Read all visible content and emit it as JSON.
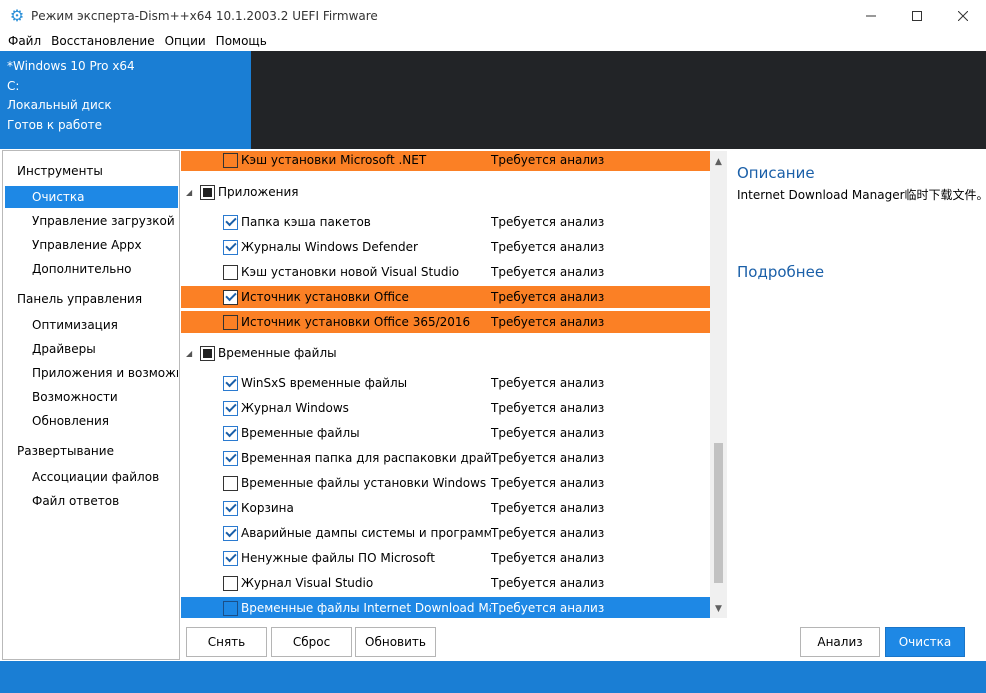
{
  "window": {
    "title": "Режим эксперта-Dism++x64 10.1.2003.2 UEFI Firmware",
    "app_icon": "gear-cluster-icon",
    "controls": [
      "minimize-icon",
      "maximize-icon",
      "close-icon"
    ]
  },
  "menu": [
    "Файл",
    "Восстановление",
    "Опции",
    "Помощь"
  ],
  "image_info": {
    "os": "*Windows 10 Pro x64",
    "drive": "C:",
    "disk": "Локальный диск",
    "status": "Готов к работе"
  },
  "sidebar": {
    "groups": [
      {
        "label": "Инструменты",
        "items": [
          {
            "label": "Очистка",
            "active": true
          },
          {
            "label": "Управление загрузкой",
            "active": false
          },
          {
            "label": "Управление Appx",
            "active": false
          },
          {
            "label": "Дополнительно",
            "active": false
          }
        ]
      },
      {
        "label": "Панель управления",
        "items": [
          {
            "label": "Оптимизация",
            "active": false
          },
          {
            "label": "Драйверы",
            "active": false
          },
          {
            "label": "Приложения и возможнос",
            "active": false
          },
          {
            "label": "Возможности",
            "active": false
          },
          {
            "label": "Обновления",
            "active": false
          }
        ]
      },
      {
        "label": "Развертывание",
        "items": [
          {
            "label": "Ассоциации файлов",
            "active": false
          },
          {
            "label": "Файл ответов",
            "active": false
          }
        ]
      }
    ]
  },
  "list": {
    "rows": [
      {
        "kind": "item",
        "name": "Кэш установки Microsoft .NET",
        "status": "Требуется анализ",
        "checked": false,
        "highlight": "orange"
      },
      {
        "kind": "group",
        "name": "Приложения",
        "state": "partial"
      },
      {
        "kind": "item",
        "name": "Папка кэша пакетов",
        "status": "Требуется анализ",
        "checked": true,
        "highlight": ""
      },
      {
        "kind": "item",
        "name": "Журналы Windows Defender",
        "status": "Требуется анализ",
        "checked": true,
        "highlight": ""
      },
      {
        "kind": "item",
        "name": "Кэш установки новой Visual Studio",
        "status": "Требуется анализ",
        "checked": false,
        "highlight": ""
      },
      {
        "kind": "item",
        "name": "Источник установки Office",
        "status": "Требуется анализ",
        "checked": true,
        "highlight": "orange"
      },
      {
        "kind": "item",
        "name": "Источник установки Office 365/2016",
        "status": "Требуется анализ",
        "checked": false,
        "highlight": "orange"
      },
      {
        "kind": "group",
        "name": "Временные файлы",
        "state": "partial"
      },
      {
        "kind": "item",
        "name": "WinSxS временные файлы",
        "status": "Требуется анализ",
        "checked": true,
        "highlight": ""
      },
      {
        "kind": "item",
        "name": "Журнал Windows",
        "status": "Требуется анализ",
        "checked": true,
        "highlight": ""
      },
      {
        "kind": "item",
        "name": "Временные файлы",
        "status": "Требуется анализ",
        "checked": true,
        "highlight": ""
      },
      {
        "kind": "item",
        "name": "Временная папка для распаковки драйверов",
        "status": "Требуется анализ",
        "checked": true,
        "highlight": ""
      },
      {
        "kind": "item",
        "name": "Временные файлы установки Windows",
        "status": "Требуется анализ",
        "checked": false,
        "highlight": ""
      },
      {
        "kind": "item",
        "name": "Корзина",
        "status": "Требуется анализ",
        "checked": true,
        "highlight": ""
      },
      {
        "kind": "item",
        "name": "Аварийные дампы системы и программ",
        "status": "Требуется анализ",
        "checked": true,
        "highlight": ""
      },
      {
        "kind": "item",
        "name": "Ненужные файлы ПО Microsoft",
        "status": "Требуется анализ",
        "checked": true,
        "highlight": ""
      },
      {
        "kind": "item",
        "name": "Журнал Visual Studio",
        "status": "Требуется анализ",
        "checked": false,
        "highlight": ""
      },
      {
        "kind": "item",
        "name": "Временные файлы Internet Download Manager",
        "status": "Требуется анализ",
        "checked": false,
        "highlight": "blue"
      }
    ]
  },
  "description": {
    "heading": "Описание",
    "text": "Internet Download Manager临时下载文件。",
    "more_heading": "Подробнее"
  },
  "buttons": {
    "uncheck": "Снять",
    "reset": "Сброс",
    "refresh": "Обновить",
    "analyze": "Анализ",
    "clean": "Очистка"
  },
  "colors": {
    "accent": "#1e88e5",
    "orange_highlight": "#fb8025",
    "dark_header": "#222427"
  }
}
